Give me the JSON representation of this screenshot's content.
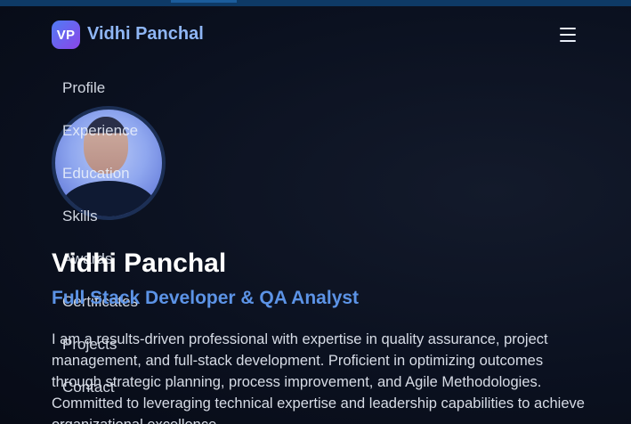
{
  "header": {
    "logo_initials": "VP",
    "brand_name": "Vidhi Panchal"
  },
  "nav": {
    "items": [
      {
        "label": "Profile"
      },
      {
        "label": "Experience"
      },
      {
        "label": "Education"
      },
      {
        "label": "Skills"
      },
      {
        "label": "Awards"
      },
      {
        "label": "Certificates"
      },
      {
        "label": "Projects"
      },
      {
        "label": "Contact"
      }
    ]
  },
  "hero": {
    "name": "Vidhi Panchal",
    "role": "Full Stack Developer & QA Analyst",
    "bio": "I am a results-driven professional with expertise in quality assurance, project management, and full-stack development. Proficient in optimizing outcomes through strategic planning, process improvement, and Agile Methodologies. Committed to leveraging technical expertise and leadership capabilities to achieve organizational excellence."
  },
  "colors": {
    "background": "#0a0f1c",
    "brand_text": "#8fb6f5",
    "role_text": "#5c93e6",
    "logo_gradient_start": "#4f7cf5",
    "logo_gradient_end": "#8b45e8"
  }
}
